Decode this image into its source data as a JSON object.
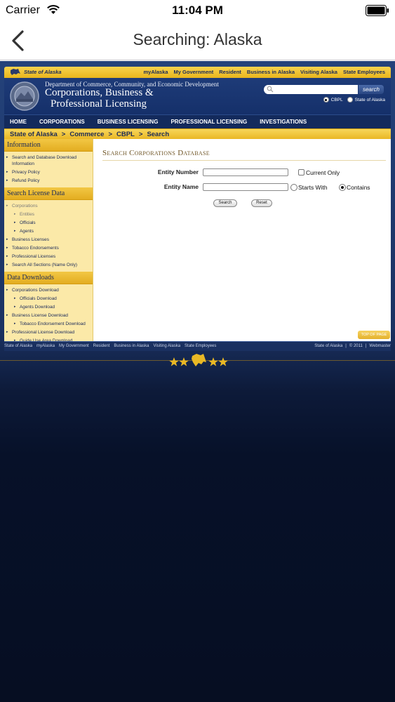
{
  "status_bar": {
    "carrier": "Carrier",
    "time": "11:04 PM"
  },
  "nav": {
    "title": "Searching: Alaska"
  },
  "site": {
    "util_logo": "State of Alaska",
    "util_links": [
      "myAlaska",
      "My Government",
      "Resident",
      "Business in Alaska",
      "Visiting Alaska",
      "State Employees"
    ],
    "dept": "Department of Commerce, Community, and Economic Development",
    "title_line1": "Corporations, Business &",
    "title_line2": "Professional Licensing",
    "search_button": "search",
    "search_placeholder": "",
    "radio_cbpl": "CBPL",
    "radio_state": "State of Alaska",
    "main_nav": [
      "HOME",
      "CORPORATIONS",
      "BUSINESS LICENSING",
      "PROFESSIONAL LICENSING",
      "INVESTIGATIONS"
    ],
    "breadcrumb": [
      "State of Alaska",
      "Commerce",
      "CBPL",
      "Search"
    ],
    "breadcrumb_sep": ">"
  },
  "sidebar": {
    "information_title": "Information",
    "information_items": [
      "Search and Database Download Information",
      "Privacy Policy",
      "Refund Policy"
    ],
    "search_title": "Search License Data",
    "search_items": [
      {
        "label": "Corporations",
        "sub": false,
        "grey": true
      },
      {
        "label": "Entities",
        "sub": true,
        "grey": true
      },
      {
        "label": "Officials",
        "sub": true,
        "grey": false
      },
      {
        "label": "Agents",
        "sub": true,
        "grey": false
      },
      {
        "label": "Business Licenses",
        "sub": false,
        "grey": false
      },
      {
        "label": "Tobacco Endorsements",
        "sub": false,
        "grey": false
      },
      {
        "label": "Professional Licenses",
        "sub": false,
        "grey": false
      },
      {
        "label": "Search All Sections (Name Only)",
        "sub": false,
        "grey": false
      }
    ],
    "downloads_title": "Data Downloads",
    "download_items": [
      {
        "label": "Corporations Download",
        "sub": false
      },
      {
        "label": "Officials Download",
        "sub": true
      },
      {
        "label": "Agents Download",
        "sub": true
      },
      {
        "label": "Business License Download",
        "sub": false
      },
      {
        "label": "Tobacco Endorsement Download",
        "sub": true
      },
      {
        "label": "Professional License Download",
        "sub": false
      },
      {
        "label": "Guide Use Area Download",
        "sub": true
      }
    ]
  },
  "main": {
    "title": "Search Corporations Database",
    "entity_number_label": "Entity Number",
    "entity_number_value": "",
    "current_only_label": "Current Only",
    "entity_name_label": "Entity Name",
    "entity_name_value": "",
    "starts_with_label": "Starts With",
    "contains_label": "Contains",
    "search_button": "Search",
    "reset_button": "Reset",
    "top_of_page": "TOP OF PAGE"
  },
  "footer": {
    "links": [
      "State of Alaska",
      "myAlaska",
      "My Government",
      "Resident",
      "Business in Alaska",
      "Visiting Alaska",
      "State Employees"
    ],
    "right_state": "State of Alaska",
    "copyright": "© 2011",
    "webmaster": "Webmaster"
  },
  "colors": {
    "navy": "#1b3262",
    "gold": "#eab725"
  }
}
